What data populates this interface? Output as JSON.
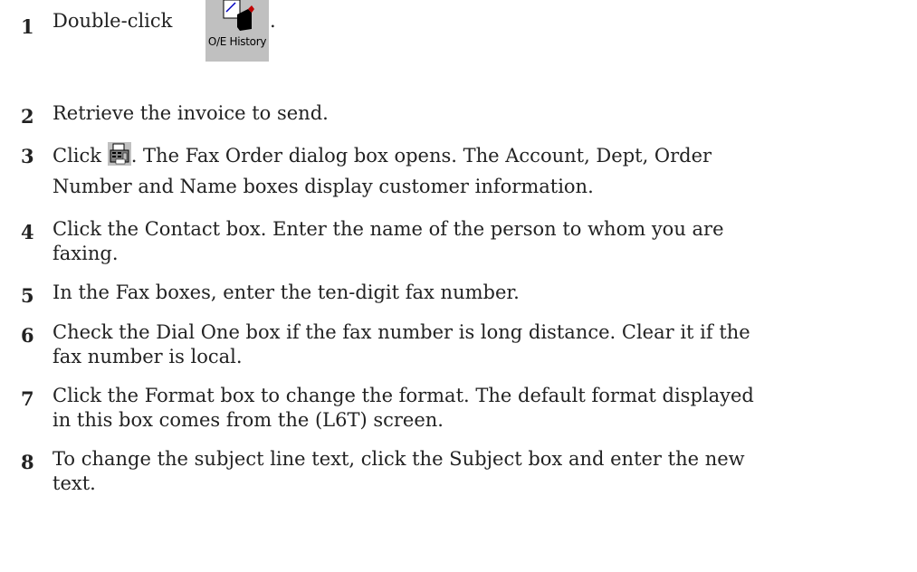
{
  "steps": [
    {
      "num": "1",
      "before": "Double-click",
      "after": "."
    },
    {
      "num": "2",
      "text": "Retrieve the invoice to send."
    },
    {
      "num": "3",
      "before": "Click",
      "after": ". The Fax Order dialog box opens. The Account, Dept, Order",
      "line2": "Number and Name boxes display customer information."
    },
    {
      "num": "4",
      "line1": "Click the Contact box. Enter the name of the person to whom you are",
      "line2": "faxing."
    },
    {
      "num": "5",
      "text": "In the Fax boxes, enter the ten-digit fax number."
    },
    {
      "num": "6",
      "line1": "Check the Dial One box if the fax number is long distance. Clear it if the",
      "line2": "fax number is local."
    },
    {
      "num": "7",
      "line1": "Click the Format box to change the format. The default format displayed",
      "line2": "in this box comes from the (L6T) screen."
    },
    {
      "num": "8",
      "line1": "To change the subject line text, click the Subject box and enter the new",
      "line2": "text."
    }
  ],
  "icons": {
    "oe_history_label": "O/E History",
    "oe_history_icon": "oe-history-icon",
    "fax_order_icon": "fax-order-icon"
  }
}
